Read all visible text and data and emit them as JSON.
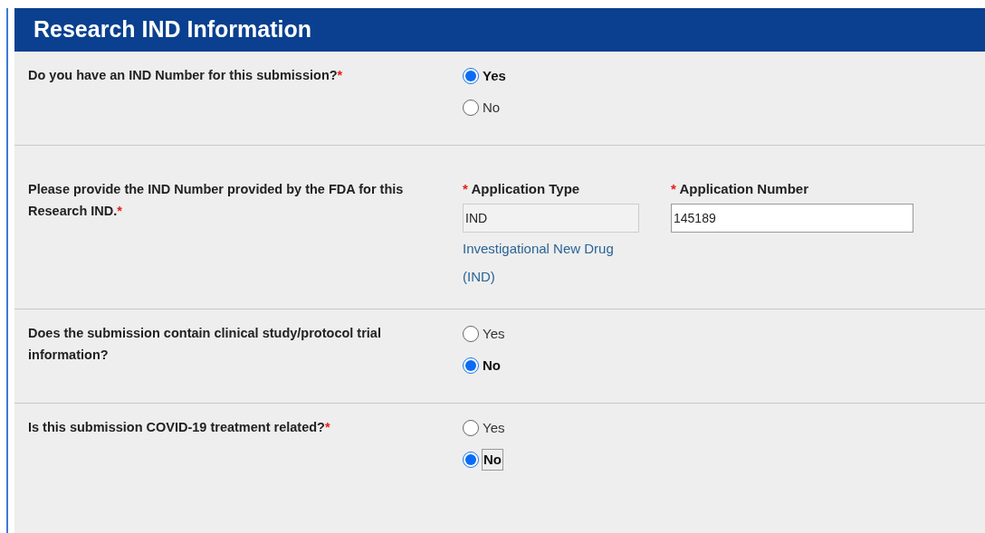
{
  "header": {
    "title": "Research IND Information"
  },
  "sections": [
    {
      "kind": "radio",
      "question": "Do you have an IND Number for this submission?",
      "required_mark": "*",
      "options": [
        {
          "label": "Yes",
          "selected": true,
          "focused": false
        },
        {
          "label": "No",
          "selected": false,
          "focused": false
        }
      ]
    },
    {
      "kind": "fields",
      "question": "Please provide the IND Number provided by the FDA for this Research IND.",
      "required_mark": "*",
      "fields": [
        {
          "mark": "*",
          "label": "Application Type",
          "value": "IND",
          "readonly": true,
          "description": "Investigational New Drug (IND)"
        },
        {
          "mark": "*",
          "label": "Application Number",
          "value": "145189",
          "readonly": false
        }
      ]
    },
    {
      "kind": "radio",
      "question": "Does the submission contain clinical study/protocol trial information?",
      "options": [
        {
          "label": "Yes",
          "selected": false,
          "focused": false
        },
        {
          "label": "No",
          "selected": true,
          "focused": false
        }
      ]
    },
    {
      "kind": "radio",
      "question": "Is this submission COVID-19 treatment related?",
      "required_mark": "*",
      "options": [
        {
          "label": "Yes",
          "selected": false,
          "focused": false
        },
        {
          "label": "No",
          "selected": true,
          "focused": true
        }
      ]
    }
  ]
}
